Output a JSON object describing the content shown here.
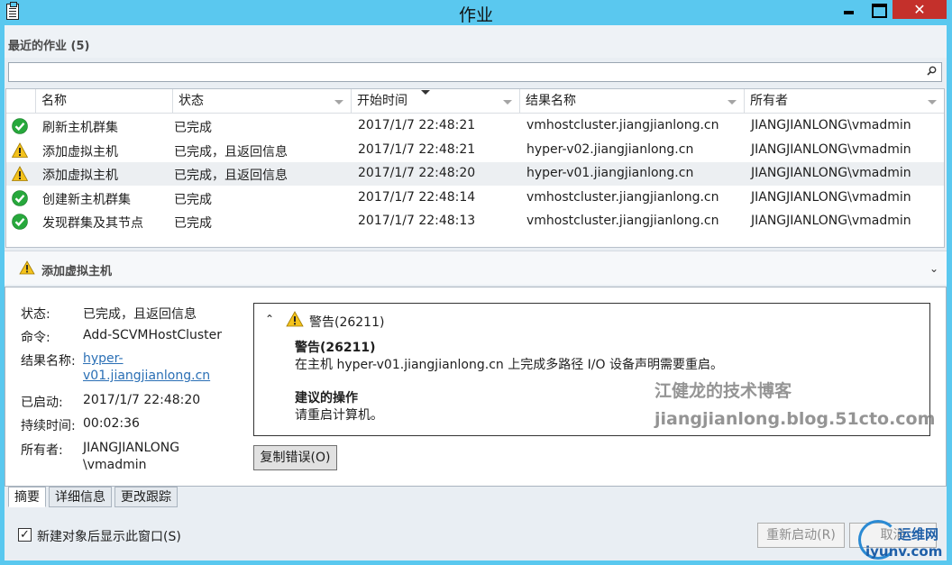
{
  "window": {
    "title": "作业"
  },
  "recent": {
    "title": "最近的作业 (5)"
  },
  "search": {
    "value": ""
  },
  "columns": {
    "name": "名称",
    "status": "状态",
    "start": "开始时间",
    "result": "结果名称",
    "owner": "所有者"
  },
  "rows": [
    {
      "icon": "success",
      "name": "刷新主机群集",
      "status": "已完成",
      "start": "2017/1/7 22:48:21",
      "result": "vmhostcluster.jiangjianlong.cn",
      "owner": "JIANGJIANLONG\\vmadmin"
    },
    {
      "icon": "warning",
      "name": "添加虚拟主机",
      "status": "已完成，且返回信息",
      "start": "2017/1/7 22:48:21",
      "result": "hyper-v02.jiangjianlong.cn",
      "owner": "JIANGJIANLONG\\vmadmin"
    },
    {
      "icon": "warning",
      "name": "添加虚拟主机",
      "status": "已完成，且返回信息",
      "start": "2017/1/7 22:48:20",
      "result": "hyper-v01.jiangjianlong.cn",
      "owner": "JIANGJIANLONG\\vmadmin"
    },
    {
      "icon": "success",
      "name": "创建新主机群集",
      "status": "已完成",
      "start": "2017/1/7 22:48:14",
      "result": "vmhostcluster.jiangjianlong.cn",
      "owner": "JIANGJIANLONG\\vmadmin"
    },
    {
      "icon": "success",
      "name": "发现群集及其节点",
      "status": "已完成",
      "start": "2017/1/7 22:48:13",
      "result": "vmhostcluster.jiangjianlong.cn",
      "owner": "JIANGJIANLONG\\vmadmin"
    }
  ],
  "detail": {
    "title": "添加虚拟主机",
    "status_key": "状态:",
    "status_val": "已完成，且返回信息",
    "command_key": "命令:",
    "command_val": "Add-SCVMHostCluster",
    "result_key": "结果名称:",
    "result_val_1": "hyper-",
    "result_val_2": "v01.jiangjianlong.cn",
    "started_key": "已启动:",
    "started_val": "2017/1/7 22:48:20",
    "duration_key": "持续时间:",
    "duration_val": "00:02:36",
    "owner_key": "所有者:",
    "owner_val_1": "JIANGJIANLONG",
    "owner_val_2": "\\vmadmin"
  },
  "warning": {
    "header": "警告(26211)",
    "title": "警告(26211)",
    "message": "在主机 hyper-v01.jiangjianlong.cn 上完成多路径 I/O 设备声明需要重启。",
    "action_title": "建议的操作",
    "action": "请重启计算机。"
  },
  "copy_button": "复制错误(O)",
  "watermark": {
    "line1": "江健龙的技术博客",
    "line2": "jiangjianlong.blog.51cto.com"
  },
  "tabs": [
    "摘要",
    "详细信息",
    "更改跟踪"
  ],
  "footer": {
    "checkbox_label": "新建对象后显示此窗口(S)",
    "checked": true,
    "restart": "重新启动(R)",
    "cancel": "取消"
  },
  "logo": {
    "t1": "运维网",
    "t2": "iyunv.com"
  },
  "colors": {
    "titlebar": "#5ac8ef",
    "close": "#c4302b",
    "link": "#2a6fb5"
  }
}
